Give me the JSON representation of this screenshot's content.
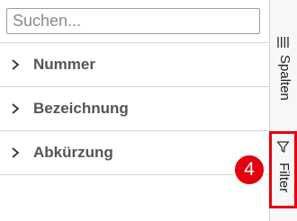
{
  "search": {
    "placeholder": "Suchen...",
    "value": ""
  },
  "groups": [
    {
      "label": "Nummer"
    },
    {
      "label": "Bezeichnung"
    },
    {
      "label": "Abkürzung"
    }
  ],
  "side_tabs": {
    "columns_label": "Spalten",
    "filter_label": "Filter"
  },
  "callout": {
    "number": "4",
    "color": "#e3000f"
  }
}
